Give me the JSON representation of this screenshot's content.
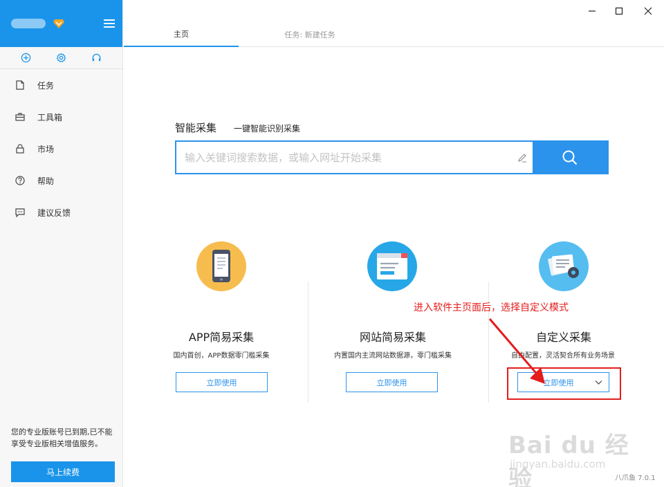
{
  "sidebar": {
    "nav": [
      {
        "label": "任务",
        "icon": "file-icon"
      },
      {
        "label": "工具箱",
        "icon": "toolbox-icon"
      },
      {
        "label": "市场",
        "icon": "bag-icon"
      },
      {
        "label": "帮助",
        "icon": "help-icon"
      },
      {
        "label": "建议反馈",
        "icon": "feedback-icon"
      }
    ],
    "expire_notice": "您的专业版账号已到期,已不能享受专业版相关增值服务。",
    "renew_label": "马上续费"
  },
  "tabs": [
    {
      "label": "主页"
    },
    {
      "label": "任务: 新建任务"
    }
  ],
  "smart": {
    "title": "智能采集",
    "subtitle": "一键智能识别采集",
    "placeholder": "输入关键词搜索数据，或输入网址开始采集"
  },
  "cards": [
    {
      "title": "APP简易采集",
      "desc": "国内首创，APP数据零门槛采集",
      "button": "立即使用"
    },
    {
      "title": "网站简易采集",
      "desc": "内置国内主流网站数据源，零门槛采集",
      "button": "立即使用"
    },
    {
      "title": "自定义采集",
      "desc": "自由配置，灵活契合所有业务场景",
      "button": "立即使用"
    }
  ],
  "annotation": "进入软件主页面后，选择自定义模式",
  "watermark": {
    "main": "Bai du 经验",
    "sub": "jingyan.baidu.com"
  },
  "version": "八爪鱼 7.0.1",
  "colors": {
    "brand": "#1a94ea",
    "accent": "#2b93ec",
    "annotation": "#e31c1c"
  }
}
